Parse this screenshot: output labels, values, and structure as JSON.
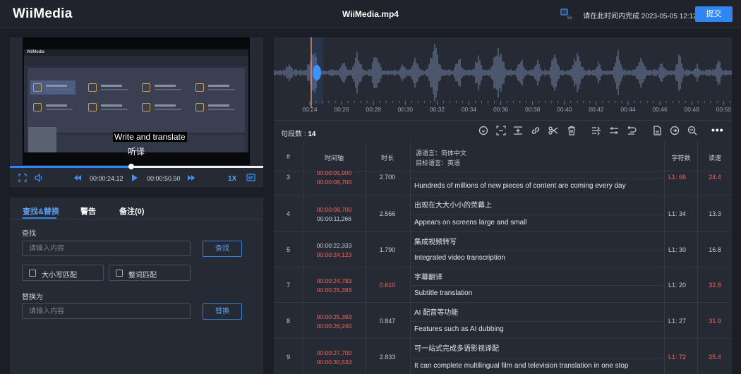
{
  "header": {
    "logo": "WiiMedia",
    "file_name": "WiiMedia.mp4",
    "deadline_text": "请在此时间内完成 2023-05-05 12:12",
    "submit_label": "提交",
    "lang_icon": "translate-icon"
  },
  "player": {
    "subtitle_en": "Write and translate",
    "subtitle_cn": "听译",
    "current_time": "00:00:24.12",
    "total_time": "00:00:50.50",
    "speed": "1X",
    "progress_percent": 48,
    "thumbnail_logo": "WiiMedia"
  },
  "find_replace": {
    "tabs": [
      "查找&替换",
      "警告",
      "备注(0)"
    ],
    "find_label": "查找",
    "find_placeholder": "请输入内容",
    "find_button": "查找",
    "match_case_label": "大小写匹配",
    "whole_word_label": "整词匹配",
    "replace_label": "替换为",
    "replace_placeholder": "请输入内容",
    "replace_button": "替换"
  },
  "waveform": {
    "ticks": [
      "00:24",
      "00:26",
      "00:28",
      "00:30",
      "00:32",
      "00:34",
      "00:36",
      "00:38",
      "00:40",
      "00:42",
      "00:44",
      "00:46",
      "00:48",
      "00:50"
    ],
    "playhead_color": "#e8875a",
    "wave_color": "#5d6985"
  },
  "toolbar": {
    "segment_label": "句段数 :",
    "segment_count": "14"
  },
  "table": {
    "headers": {
      "num": "#",
      "timeline": "时间轴",
      "duration": "时长",
      "source_lang": "源语言：简体中文",
      "target_lang": "目标语言：英语",
      "char_count": "字符数",
      "speed": "读速"
    },
    "rows": [
      {
        "num": "3",
        "start": "00:00:05,900",
        "end": "00:00:08,700",
        "duration": "2.700",
        "source": "",
        "target": "Hundreds of millions of new pieces of content are coming every day",
        "chars": "L1: 66",
        "speed": "24.4",
        "start_red": true,
        "end_red": true,
        "duration_red": false,
        "chars_red": true,
        "speed_red": true
      },
      {
        "num": "4",
        "start": "00:00:08,700",
        "end": "00:00:11,266",
        "duration": "2.566",
        "source": "出现在大大小小的荧幕上",
        "target": "Appears on screens large and small",
        "chars": "L1: 34",
        "speed": "13.3",
        "start_red": true,
        "end_red": false,
        "duration_red": false,
        "chars_red": false,
        "speed_red": false
      },
      {
        "num": "5",
        "start": "00:00:22,333",
        "end": "00:00:24,123",
        "duration": "1.790",
        "source": "集成视频转写",
        "target": "Integrated video transcription",
        "chars": "L1: 30",
        "speed": "16.8",
        "start_red": false,
        "end_red": true,
        "duration_red": false,
        "chars_red": false,
        "speed_red": false
      },
      {
        "num": "7",
        "start": "00:00:24,783",
        "end": "00:00:25,393",
        "duration": "0.610",
        "source": "字幕翻译",
        "target": "Subtitle translation",
        "chars": "L1: 20",
        "speed": "32.8",
        "start_red": true,
        "end_red": true,
        "duration_red": true,
        "chars_red": false,
        "speed_red": true
      },
      {
        "num": "8",
        "start": "00:00:25,393",
        "end": "00:00:26,240",
        "duration": "0.847",
        "source": "AI 配音等功能",
        "target": "Features such as AI dubbing",
        "chars": "L1: 27",
        "speed": "31.9",
        "start_red": true,
        "end_red": true,
        "duration_red": false,
        "chars_red": false,
        "speed_red": true
      },
      {
        "num": "9",
        "start": "00:00:27,700",
        "end": "00:00:30,533",
        "duration": "2.833",
        "source": "可一站式完成多语影视译配",
        "target": "It can complete multilingual film and television translation in one stop",
        "chars": "L1: 72",
        "speed": "25.4",
        "start_red": true,
        "end_red": true,
        "duration_red": false,
        "chars_red": true,
        "speed_red": true
      }
    ]
  },
  "colors": {
    "accent": "#2f86f2",
    "warning_red": "#f2685c",
    "background": "#1b1e26",
    "panel": "#262a34"
  }
}
